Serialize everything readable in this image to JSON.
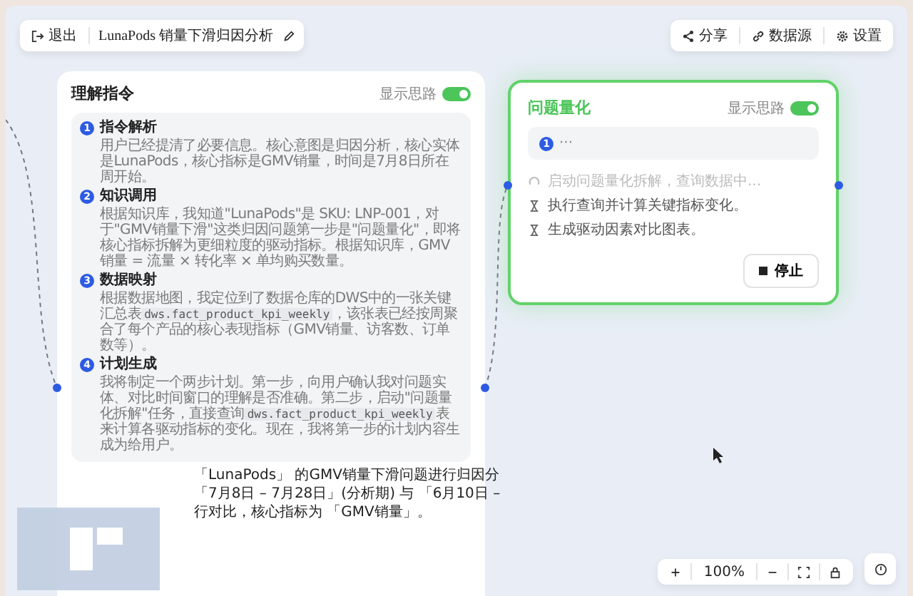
{
  "topbar": {
    "exit": "退出",
    "title": "LunaPods 销量下滑归因分析",
    "actions": [
      {
        "kind": "share",
        "label": "分享"
      },
      {
        "kind": "link",
        "label": "数据源"
      },
      {
        "kind": "gear",
        "label": "设置"
      }
    ]
  },
  "left_card": {
    "title": "理解指令",
    "toggle": {
      "label": "显示思路",
      "on": true
    },
    "sections": [
      {
        "number": "1",
        "heading": "指令解析",
        "text": "用户已经提清了必要信息。核心意图是归因分析，核心实体是LunaPods，核心指标是GMV销量，时间是7月8日所在周开始。"
      },
      {
        "number": "2",
        "heading": "知识调用",
        "text": "根据知识库，我知道\"LunaPods\"是 SKU: LNP-001，对于\"GMV销量下滑\"这类归因问题第一步是\"问题量化\"，即将核心指标拆解为更细粒度的驱动指标。根据知识库，GMV销量 = 流量 × 转化率 × 单均购买数量。"
      },
      {
        "number": "3",
        "heading": "数据映射",
        "text": "根据数据地图，我定位到了数据仓库的DWS中的一张关键汇总表",
        "code": "dws.fact_product_kpi_weekly",
        "after": "，该张表已经按周聚合了每个产品的核心表现指标（GMV销量、访客数、订单数等）。"
      },
      {
        "number": "4",
        "heading": "计划生成",
        "text": "我将制定一个两步计划。第一步，向用户确认我对问题实体、对比时间窗口的理解是否准确。第二步，启动\"问题量化拆解\"任务，直接查询",
        "code": "dws.fact_product_kpi_weekly",
        "after": "表来计算各驱动指标的变化。现在，我将第一步的计划内容生成为给用户。"
      }
    ],
    "message_lines": [
      "「LunaPods」 的GMV销量下滑问题进行归因分",
      "「7月8日 – 7月28日」(分析期) 与 「6月10日 –",
      "行对比，核心指标为 「GMV销量」。"
    ]
  },
  "right_card": {
    "title": "问题量化",
    "toggle": {
      "label": "显示思路",
      "on": true
    },
    "thinking": {
      "number": "1",
      "text": "···"
    },
    "steps": [
      {
        "kind": "running",
        "text": "启动问题量化拆解，查询数据中..."
      },
      {
        "kind": "pending",
        "text": "执行查询并计算关键指标变化。"
      },
      {
        "kind": "pending",
        "text": "生成驱动因素对比图表。"
      }
    ],
    "stop": "停止"
  },
  "zoom": {
    "level_text": "100%"
  }
}
